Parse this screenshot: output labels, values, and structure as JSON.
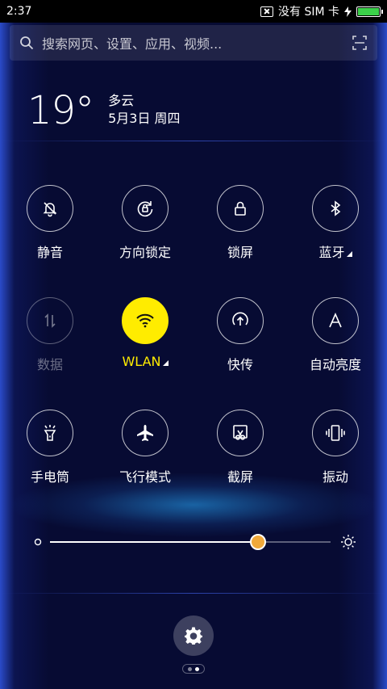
{
  "status_bar": {
    "time": "2:37",
    "sim_text": "没有 SIM 卡",
    "battery_level": 1.0
  },
  "search": {
    "placeholder": "搜索网页、设置、应用、视频..."
  },
  "weather": {
    "temperature": "19°",
    "condition": "多云",
    "date": "5月3日 周四"
  },
  "toggles": [
    {
      "label": "静音",
      "icon": "bell-off-icon",
      "state": "off"
    },
    {
      "label": "方向锁定",
      "icon": "rotation-lock-icon",
      "state": "off"
    },
    {
      "label": "锁屏",
      "icon": "lock-icon",
      "state": "off"
    },
    {
      "label": "蓝牙",
      "icon": "bluetooth-icon",
      "state": "off"
    },
    {
      "label": "数据",
      "icon": "mobile-data-icon",
      "state": "disabled"
    },
    {
      "label": "WLAN",
      "icon": "wifi-icon",
      "state": "on"
    },
    {
      "label": "快传",
      "icon": "share-upload-icon",
      "state": "off"
    },
    {
      "label": "自动亮度",
      "icon": "auto-brightness-icon",
      "state": "off"
    },
    {
      "label": "手电筒",
      "icon": "flashlight-icon",
      "state": "off"
    },
    {
      "label": "飞行模式",
      "icon": "airplane-icon",
      "state": "off"
    },
    {
      "label": "截屏",
      "icon": "screenshot-icon",
      "state": "off"
    },
    {
      "label": "振动",
      "icon": "vibrate-icon",
      "state": "off"
    }
  ],
  "brightness": {
    "level": 0.74
  },
  "colors": {
    "accent": "#ffec00",
    "thumb": "#f0a93a",
    "battery": "#3bd14a"
  }
}
